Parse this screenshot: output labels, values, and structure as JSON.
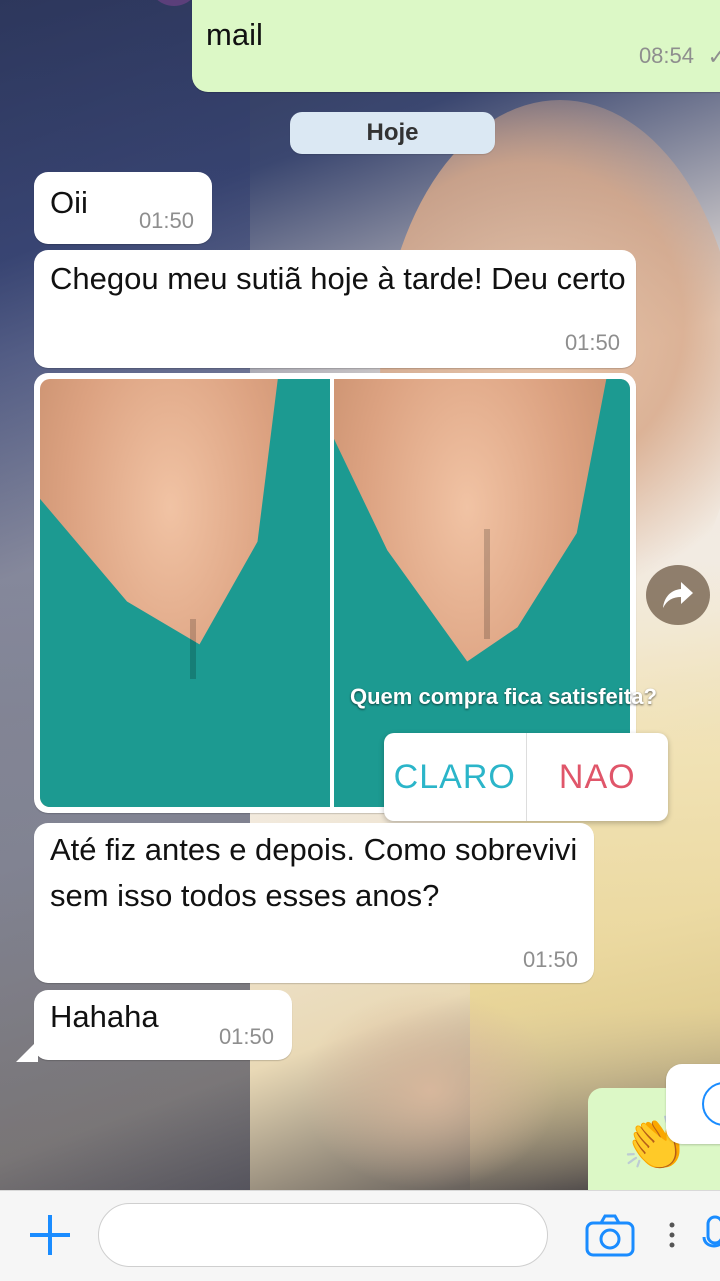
{
  "chat": {
    "top_message": {
      "text": "mail",
      "time": "08:54"
    },
    "date_label": "Hoje",
    "messages": [
      {
        "text": "Oii",
        "time": "01:50"
      },
      {
        "text": "Chegou meu sutiã hoje à tarde! Deu certo",
        "time": "01:50"
      },
      {
        "text": "Até fiz antes e depois. Como sobrevivi sem isso todos esses anos?",
        "time": "01:50"
      },
      {
        "text": "Hahaha",
        "time": "01:50"
      }
    ],
    "image_message": {
      "poll_question": "Quem compra fica satisfeita?",
      "poll_options": [
        "CLARO",
        "NAO"
      ]
    },
    "outgoing_emoji": "👏"
  },
  "input": {
    "placeholder": ""
  },
  "colors": {
    "outgoing_bubble": "#dcf8c6",
    "incoming_bubble": "#ffffff",
    "accent_blue": "#1a8cff",
    "poll_yes": "#2bb5c9",
    "poll_no": "#e0566a",
    "shirt_teal": "#1c9a91"
  },
  "icons": [
    "check-icon",
    "share-icon",
    "plus-icon",
    "camera-icon",
    "more-icon",
    "mic-icon",
    "scroll-down-icon"
  ]
}
